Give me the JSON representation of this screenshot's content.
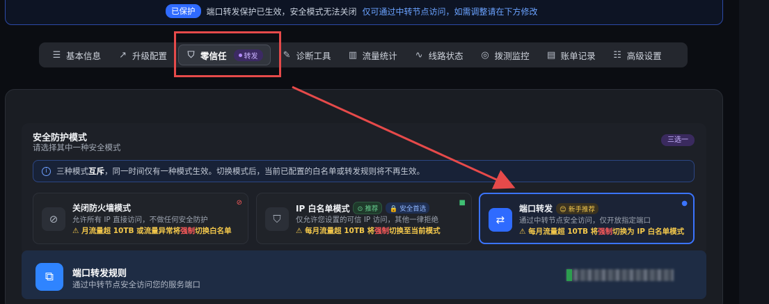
{
  "banner": {
    "badge": "已保护",
    "text": "端口转发保护已生效，安全模式无法关闭",
    "link": "仅可通过中转节点访问，如需调整请在下方修改"
  },
  "tabs": [
    {
      "label": "基本信息",
      "icon": "list-icon"
    },
    {
      "label": "升级配置",
      "icon": "trend-up-icon"
    },
    {
      "label": "零信任",
      "icon": "shield-icon",
      "tag": "转发",
      "active": true
    },
    {
      "label": "诊断工具",
      "icon": "wrench-icon"
    },
    {
      "label": "流量统计",
      "icon": "bar-chart-icon"
    },
    {
      "label": "线路状态",
      "icon": "pulse-icon"
    },
    {
      "label": "拨测监控",
      "icon": "radar-icon"
    },
    {
      "label": "账单记录",
      "icon": "bill-icon"
    },
    {
      "label": "高级设置",
      "icon": "sliders-icon"
    }
  ],
  "security": {
    "title": "安全防护模式",
    "subtitle": "请选择其中一种安全模式",
    "badge": "三选一",
    "info_prefix": "三种模式",
    "info_bold": "互斥",
    "info_suffix": "，同一时间仅有一种模式生效。切换模式后，当前已配置的白名单或转发规则将不再生效。",
    "modes": [
      {
        "title": "关闭防火墙模式",
        "desc": "允许所有 IP 直接访问，不做任何安全防护",
        "warn_a": "⚠ 月流量超 10TB 或流量异常将",
        "warn_hl": "强制",
        "warn_b": "切换白名单",
        "icon": "shield-off-icon"
      },
      {
        "title": "IP 白名单模式",
        "pill1": "⊙ 推荐",
        "pill2": "🔒 安全首选",
        "desc": "仅允许您设置的可信 IP 访问，其他一律拒绝",
        "warn_a": "⚠ 每月流量超 10TB 将",
        "warn_hl": "强制",
        "warn_b": "切换至当前模式",
        "icon": "shield-check-icon"
      },
      {
        "title": "端口转发",
        "pill1": "😊 新手推荐",
        "desc": "通过中转节点安全访问，仅开放指定端口",
        "warn_a": "⚠ 每月流量超 10TB 将",
        "warn_hl": "强制",
        "warn_b": "切换为 IP 白名单模式",
        "icon": "swap-arrows-icon",
        "selected": true
      }
    ]
  },
  "rules": {
    "title": "端口转发规则",
    "subtitle": "通过中转节点安全访问您的服务端口"
  },
  "colors": {
    "accent": "#2f6bff",
    "annotation_red": "#e64a4a",
    "warn": "#f4c84b"
  }
}
